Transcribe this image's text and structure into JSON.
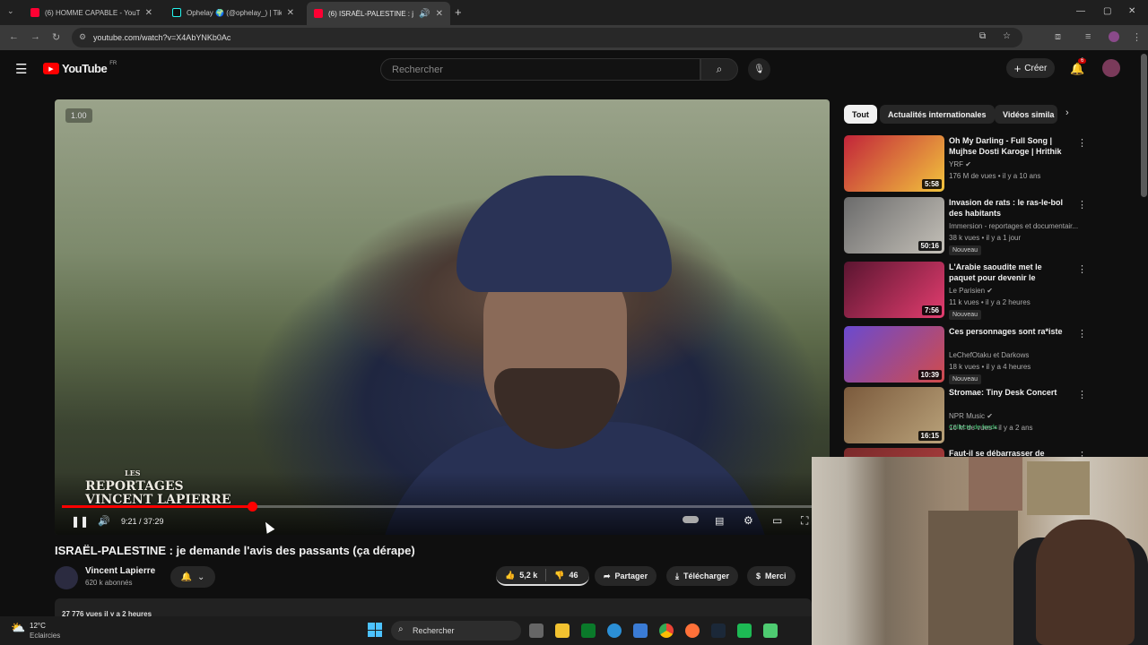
{
  "browser": {
    "tabs": [
      {
        "title": "(6) HOMME CAPABLE - YouTube",
        "favicon_color": "#ff0033"
      },
      {
        "title": "Ophelay 🌍 (@ophelay_) | TikTok",
        "favicon_color": "#25f4ee"
      },
      {
        "title": "(6) ISRAËL-PALESTINE : je demande l'avis",
        "favicon_color": "#ff0033"
      }
    ],
    "url": "youtube.com/watch?v=X4AbYNKb0Ac"
  },
  "youtube": {
    "logo_text": "YouTube",
    "region": "FR",
    "search_placeholder": "Rechercher",
    "create_label": "Créer",
    "notification_count": "6"
  },
  "player": {
    "speed": "1.00",
    "time": "9:21 / 37:29",
    "progress_fraction": 0.25,
    "watermark_top": "LES",
    "watermark_mid": "REPORTAGES",
    "watermark_bottom": "VINCENT LAPIERRE"
  },
  "video": {
    "title": "ISRAËL-PALESTINE : je demande l'avis des passants (ça dérape)",
    "channel": "Vincent Lapierre",
    "subscribers": "620 k abonnés",
    "likes": "5,2 k",
    "dislikes": "46",
    "share_label": "Partager",
    "download_label": "Télécharger",
    "thanks_label": "Merci",
    "views_line": "27 776 vues  il y a 2 heures"
  },
  "sidebar": {
    "chips": [
      "Tout",
      "Actualités internationales",
      "Vidéos simila"
    ],
    "recommendations": [
      {
        "title": "Oh My Darling - Full Song | Mujhse Dosti Karoge | Hrithik ...",
        "channel": "YRF ✔",
        "meta": "176 M de vues • il y a 10 ans",
        "duration": "5:58",
        "badge": "",
        "thumb_colors": [
          "#c2243a",
          "#f2c43d"
        ]
      },
      {
        "title": "Invasion de rats : le ras-le-bol des habitants",
        "channel": "Immersion - reportages et documentair...",
        "meta": "38 k vues • il y a 1 jour",
        "duration": "50:16",
        "badge": "Nouveau",
        "thumb_colors": [
          "#6b6b6b",
          "#c4c0b8"
        ]
      },
      {
        "title": "L'Arabie saoudite met le paquet pour devenir le royaume du jeu...",
        "channel": "Le Parisien ✔",
        "meta": "11 k vues • il y a 2 heures",
        "duration": "7:56",
        "badge": "Nouveau",
        "thumb_colors": [
          "#5a1530",
          "#e33d6f"
        ]
      },
      {
        "title": "Ces personnages sont ra*iste",
        "channel": "LeChefOtaku et Darkows",
        "meta": "18 k vues • il y a 4 heures",
        "duration": "10:39",
        "badge": "Nouveau",
        "thumb_colors": [
          "#6a4ad0",
          "#d14b4b"
        ]
      },
      {
        "title": "Stromae: Tiny Desk Concert",
        "channel": "NPR Music ✔",
        "meta": "16 M de vues • il y a 2 ans",
        "duration": "16:15",
        "badge": "Collecte de fonds",
        "thumb_colors": [
          "#7b5a3c",
          "#b9a27a"
        ]
      },
      {
        "title": "Faut-il se débarrasser de",
        "channel": "",
        "meta": "",
        "duration": "",
        "badge": "",
        "thumb_colors": [
          "#7a2a2a",
          "#b04040"
        ]
      }
    ]
  },
  "taskbar": {
    "weather_temp": "12°C",
    "weather_desc": "Eclaircies",
    "search_label": "Rechercher"
  }
}
